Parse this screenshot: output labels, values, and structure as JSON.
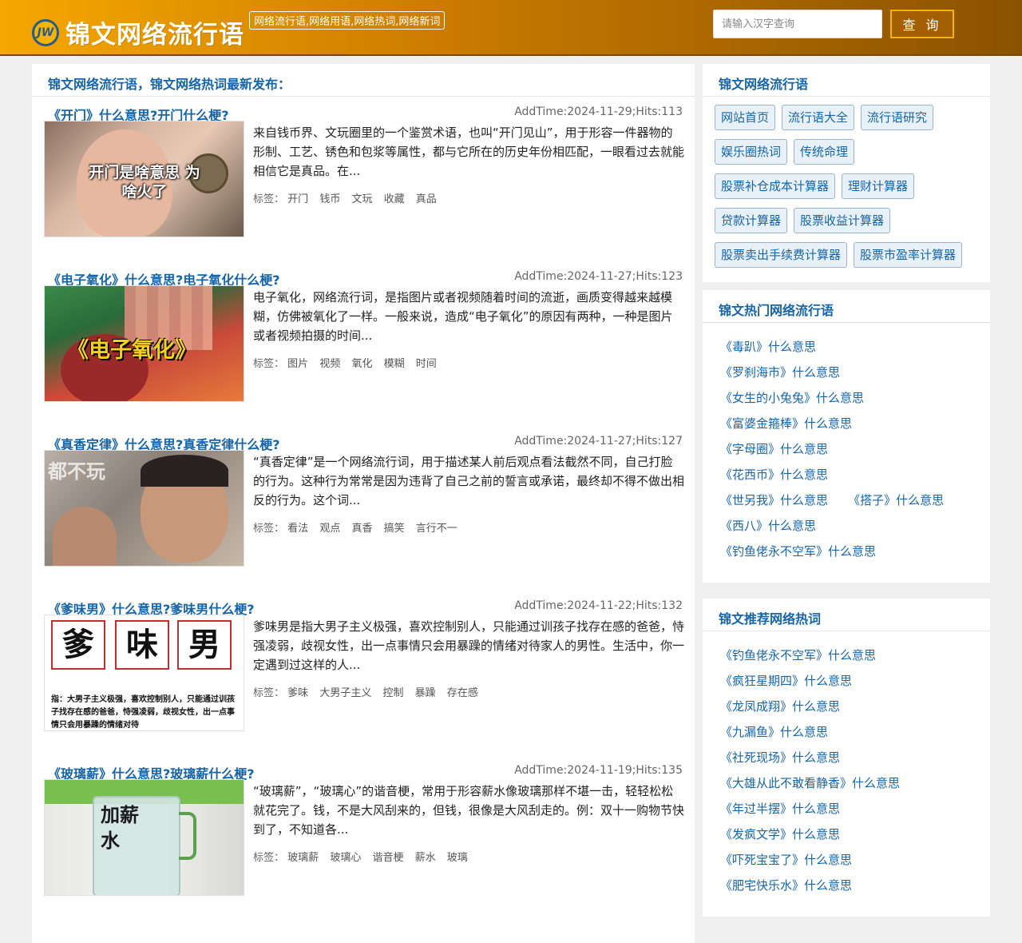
{
  "header": {
    "logo_badge": "JW",
    "site_title": "锦文网络流行语",
    "tagline": "网络流行语,网络用语,网络热词,网络新词",
    "search_placeholder": "请输入汉字查询",
    "search_button": "查 询"
  },
  "main": {
    "heading": "锦文网络流行语，锦文网络热词最新发布：",
    "tags_label": "标签：",
    "articles": [
      {
        "title": "《开门》什么意思?开门什么梗?",
        "meta": "AddTime:2024-11-29;Hits:113",
        "thumb_caption": "开门是啥意思 为啥火了",
        "desc": "来自钱币界、文玩圈里的一个鉴赏术语，也叫“开门见山”，用于形容一件器物的形制、工艺、锈色和包浆等属性，都与它所在的历史年份相匹配，一眼看过去就能相信它是真品。在...",
        "tags": [
          "开门",
          "钱币",
          "文玩",
          "收藏",
          "真品"
        ]
      },
      {
        "title": "《电子氧化》什么意思?电子氧化什么梗?",
        "meta": "AddTime:2024-11-27;Hits:123",
        "thumb_caption": "《电子氧化》",
        "desc": "电子氧化，网络流行词，是指图片或者视频随着时间的流逝，画质变得越来越模糊，仿佛被氧化了一样。一般来说，造成“电子氧化”的原因有两种，一种是图片或者视频拍摄的时间...",
        "tags": [
          "图片",
          "视频",
          "氧化",
          "模糊",
          "时间"
        ]
      },
      {
        "title": "《真香定律》什么意思?真香定律什么梗?",
        "meta": "AddTime:2024-11-27;Hits:127",
        "thumb_caption": "都不玩",
        "desc": "“真香定律”是一个网络流行词，用于描述某人前后观点看法截然不同，自己打脸的行为。这种行为常常是因为违背了自己之前的誓言或承诺，最终却不得不做出相反的行为。这个词...",
        "tags": [
          "看法",
          "观点",
          "真香",
          "搞笑",
          "言行不一"
        ]
      },
      {
        "title": "《爹味男》什么意思?爹味男什么梗?",
        "meta": "AddTime:2024-11-22;Hits:132",
        "thumb_chars": [
          "爹",
          "味",
          "男"
        ],
        "thumb_caption": "指：大男子主义极强，喜欢控制别人，只能通过训孩子找存在感的爸爸，恃强凌弱，歧视女性，出一点事情只会用暴躁的情绪对待",
        "desc": "爹味男是指大男子主义极强，喜欢控制别人，只能通过训孩子找存在感的爸爸，恃强凌弱，歧视女性，出一点事情只会用暴躁的情绪对待家人的男性。生活中，你一定遇到过这样的人...",
        "tags": [
          "爹味",
          "大男子主义",
          "控制",
          "暴躁",
          "存在感"
        ]
      },
      {
        "title": "《玻璃薪》什么意思?玻璃薪什么梗?",
        "meta": "AddTime:2024-11-19;Hits:135",
        "thumb_caption": "加薪水",
        "desc": "“玻璃薪”，“玻璃心”的谐音梗，常用于形容薪水像玻璃那样不堪一击，轻轻松松就花完了。钱，不是大风刮来的，但钱，很像是大风刮走的。例：双十一购物节快到了，不知道各...",
        "tags": [
          "玻璃薪",
          "玻璃心",
          "谐音梗",
          "薪水",
          "玻璃"
        ]
      }
    ]
  },
  "sidebar": {
    "nav": {
      "heading": "锦文网络流行语",
      "items": [
        "网站首页",
        "流行语大全",
        "流行语研究",
        "娱乐圈热词",
        "传统命理",
        "股票补仓成本计算器",
        "理财计算器",
        "贷款计算器",
        "股票收益计算器",
        "股票卖出手续费计算器",
        "股票市盈率计算器"
      ]
    },
    "hot": {
      "heading": "锦文热门网络流行语",
      "items": [
        "《毒趴》什么意思",
        "《罗刹海市》什么意思",
        "《女生的小兔兔》什么意思",
        "《富婆金箍棒》什么意思",
        "《字母圈》什么意思",
        "《花西币》什么意思",
        "《世另我》什么意思",
        "《搭子》什么意思",
        "《西八》什么意思",
        "《钓鱼佬永不空军》什么意思"
      ]
    },
    "recommend": {
      "heading": "锦文推荐网络热词",
      "items": [
        "《钓鱼佬永不空军》什么意思",
        "《疯狂星期四》什么意思",
        "《龙凤成翔》什么意思",
        "《九漏鱼》什么意思",
        "《社死现场》什么意思",
        "《大雄从此不敢看静香》什么意思",
        "《年过半摆》什么意思",
        "《发疯文学》什么意思",
        "《吓死宝宝了》什么意思",
        "《肥宅快乐水》什么意思"
      ]
    }
  }
}
